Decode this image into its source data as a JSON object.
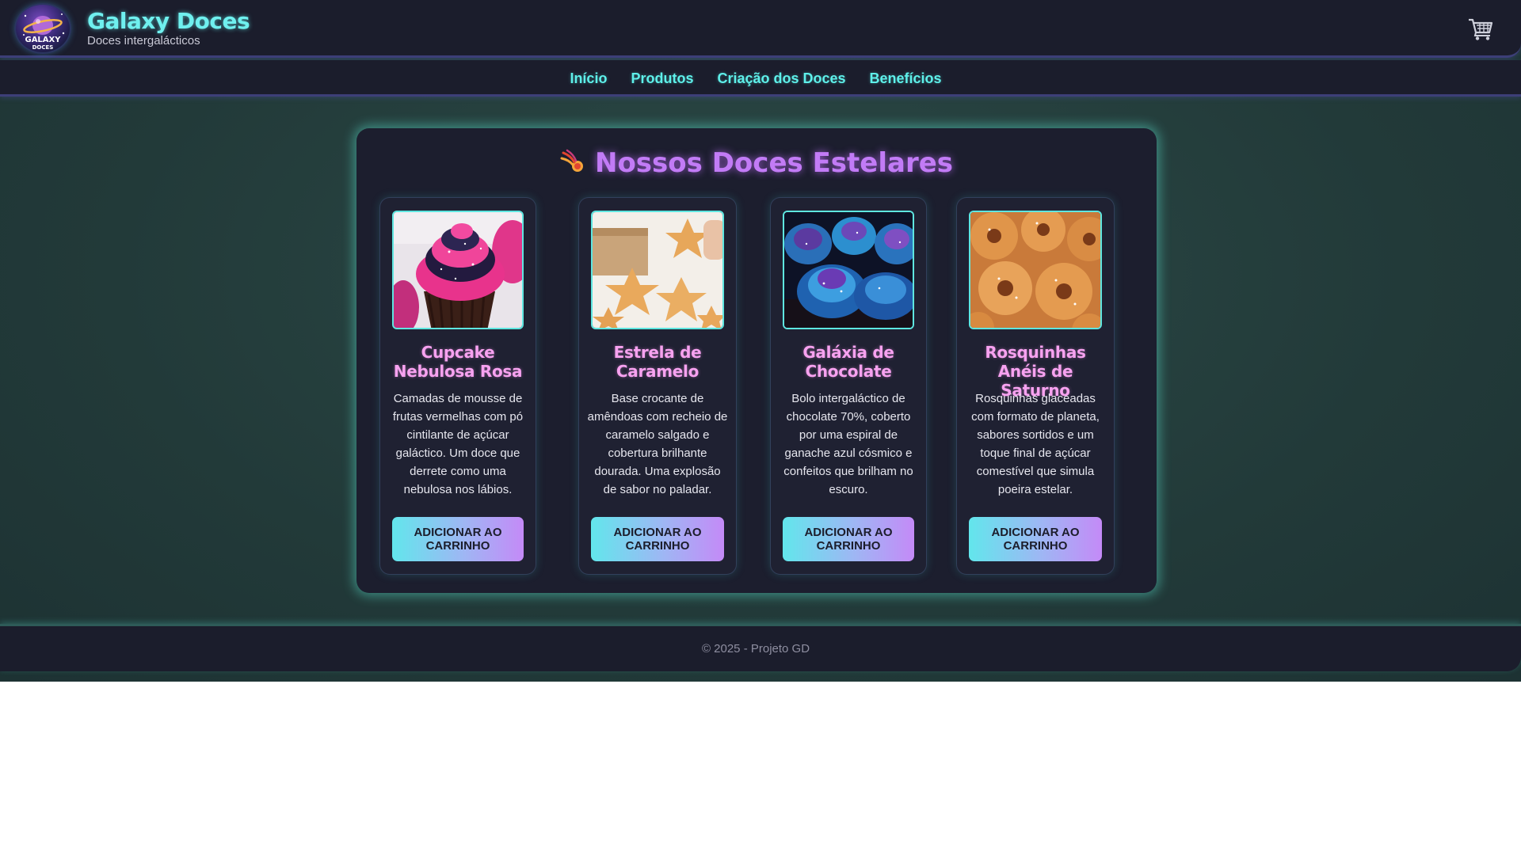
{
  "header": {
    "logo_line1": "GALAXY",
    "logo_line2": "DOCES",
    "title": "Galaxy Doces",
    "subtitle": "Doces intergalácticos",
    "cart_icon": "cart-icon"
  },
  "nav": {
    "links": [
      {
        "label": "Início"
      },
      {
        "label": "Produtos"
      },
      {
        "label": "Criação dos Doces"
      },
      {
        "label": "Benefícios"
      }
    ]
  },
  "section": {
    "title": "Nossos Doces Estelares",
    "icon": "comet-icon"
  },
  "products": [
    {
      "name": "Cupcake Nebulosa Rosa",
      "description": "Camadas de mousse de frutas vermelhas com pó cintilante de açúcar galáctico. Um doce que derrete como uma nebulosa nos lábios.",
      "button": "ADICIONAR AO CARRINHO",
      "image": "pink-galaxy-cupcake"
    },
    {
      "name": "Estrela de Caramelo",
      "description": "Base crocante de amêndoas com recheio de caramelo salgado e cobertura brilhante dourada. Uma explosão de sabor no paladar.",
      "button": "ADICIONAR AO CARRINHO",
      "image": "star-cookies"
    },
    {
      "name": "Galáxia de Chocolate",
      "description": "Bolo intergaláctico de chocolate 70%, coberto por uma espiral de ganache azul cósmico e confeitos que brilham no escuro.",
      "button": "ADICIONAR AO CARRINHO",
      "image": "blue-galaxy-cupcakes"
    },
    {
      "name": "Rosquinhas Anéis de Saturno",
      "description": "Rosquinhas glaceadas com formato de planeta, sabores sortidos e um toque final de açúcar comestível que simula poeira estelar.",
      "button": "ADICIONAR AO CARRINHO",
      "image": "sugar-donuts"
    }
  ],
  "footer": {
    "copyright": "© 2025 - Projeto GD"
  },
  "colors": {
    "accent_cyan": "#5ef0ea",
    "accent_purple": "#c27bf6",
    "accent_pink": "#f7a2f0",
    "panel_bg": "#1c1e2e",
    "page_bg": "#223a39"
  }
}
